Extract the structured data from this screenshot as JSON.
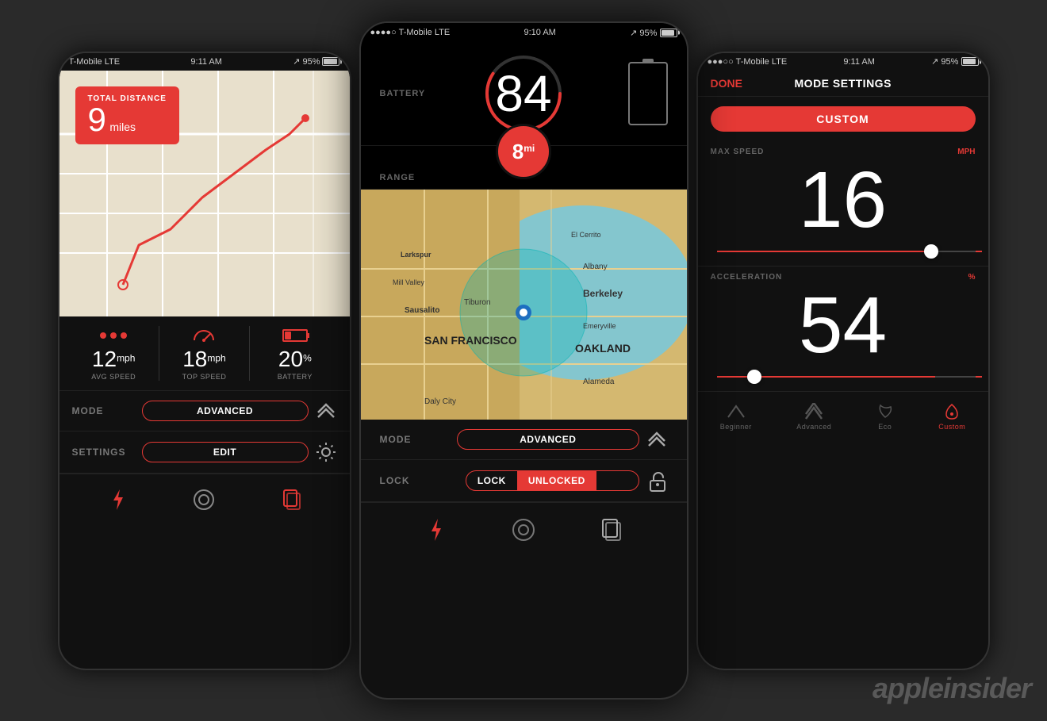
{
  "app": {
    "watermark": "appleinsider"
  },
  "left_phone": {
    "status_bar": {
      "carrier": "T-Mobile LTE",
      "time": "9:11 AM",
      "battery": "95%"
    },
    "map": {
      "total_distance_label": "TOTAL DISTANCE",
      "total_distance_value": "9",
      "total_distance_unit": "miles"
    },
    "stats": [
      {
        "value": "12",
        "unit": "mph",
        "label": "AVG SPEED"
      },
      {
        "value": "18",
        "unit": "mph",
        "label": "TOP SPEED"
      },
      {
        "value": "20",
        "unit": "%",
        "label": "BATTERY"
      }
    ],
    "mode_row": {
      "label": "MODE",
      "button": "ADVANCED"
    },
    "settings_row": {
      "label": "SETTINGS",
      "button": "EDIT"
    }
  },
  "center_phone": {
    "status_bar": {
      "carrier": "●●●●○ T-Mobile  LTE",
      "time": "9:10 AM",
      "battery": "95%"
    },
    "battery": {
      "label": "BATTERY",
      "value": "84"
    },
    "range": {
      "label": "RANGE",
      "value": "8",
      "unit": "mi"
    },
    "mode_row": {
      "label": "MODE",
      "button": "ADVANCED"
    },
    "lock_row": {
      "label": "LOCK",
      "option1": "LOCK",
      "option2": "UNLOCKED",
      "active": "option2"
    }
  },
  "right_phone": {
    "status_bar": {
      "carrier": "●●●○○ T-Mobile  LTE",
      "time": "9:11 AM",
      "battery": "95%"
    },
    "header": {
      "done": "DONE",
      "title": "MODE SETTINGS"
    },
    "custom_button": "CUSTOM",
    "max_speed": {
      "label": "MAX SPEED",
      "unit": "MPH",
      "value": "16"
    },
    "acceleration": {
      "label": "ACCELERATION",
      "unit": "%",
      "value": "54"
    },
    "tabs": [
      {
        "label": "Beginner",
        "active": false
      },
      {
        "label": "Advanced",
        "active": false
      },
      {
        "label": "Eco",
        "active": false
      },
      {
        "label": "Custom",
        "active": true
      }
    ]
  }
}
